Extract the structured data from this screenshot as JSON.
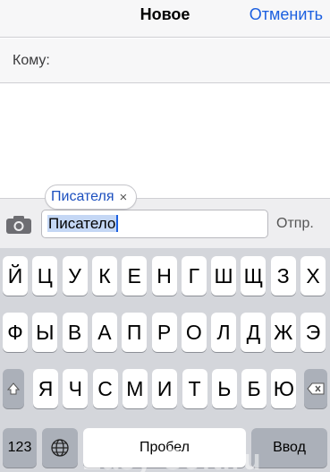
{
  "nav": {
    "title": "Новое",
    "cancel_label": "Отменить"
  },
  "to_row": {
    "label": "Кому:"
  },
  "suggestion": {
    "label": "Писателя",
    "remove_glyph": "×"
  },
  "input": {
    "value": "Писатело",
    "send_label": "Отпр."
  },
  "keyboard": {
    "row1": [
      "Й",
      "Ц",
      "У",
      "К",
      "Е",
      "Н",
      "Г",
      "Ш",
      "Щ",
      "З",
      "Х"
    ],
    "row2": [
      "Ф",
      "Ы",
      "В",
      "А",
      "П",
      "Р",
      "О",
      "Л",
      "Д",
      "Ж",
      "Э"
    ],
    "row3": [
      "Я",
      "Ч",
      "С",
      "М",
      "И",
      "Т",
      "Ь",
      "Б",
      "Ю"
    ],
    "numbers_label": "123",
    "space_label": "Пробел",
    "return_label": "Ввод",
    "shift_icon": "shift-icon",
    "backspace_icon": "backspace-icon",
    "globe_icon": "globe-icon"
  },
  "watermark": "Easy-Soft.ru",
  "colors": {
    "accent": "#1b5fe0",
    "keyboard_bg": "#d4d6db"
  }
}
